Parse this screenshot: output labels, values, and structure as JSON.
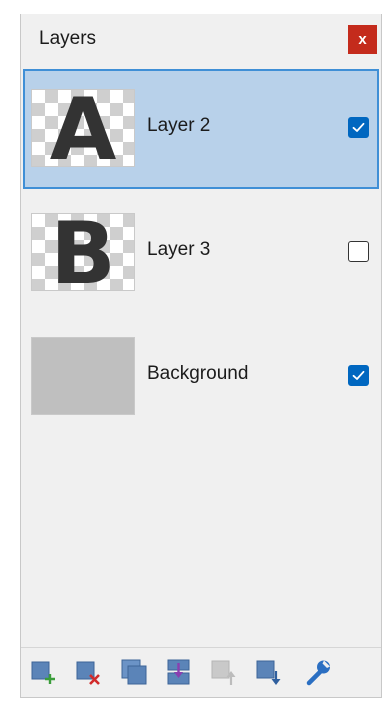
{
  "panel": {
    "title": "Layers",
    "close_label": "x"
  },
  "layers": [
    {
      "name": "Layer 2",
      "thumbnail_letter": "A",
      "visible": true,
      "selected": true
    },
    {
      "name": "Layer 3",
      "thumbnail_letter": "B",
      "visible": false,
      "selected": false
    },
    {
      "name": "Background",
      "thumbnail_letter": "",
      "visible": true,
      "selected": false
    }
  ],
  "toolbar": {
    "tools": [
      {
        "icon": "add-layer-icon",
        "enabled": true
      },
      {
        "icon": "delete-layer-icon",
        "enabled": true
      },
      {
        "icon": "duplicate-layer-icon",
        "enabled": true
      },
      {
        "icon": "merge-layer-down-icon",
        "enabled": true
      },
      {
        "icon": "move-layer-up-icon",
        "enabled": false
      },
      {
        "icon": "move-layer-down-icon",
        "enabled": true
      },
      {
        "icon": "layer-properties-icon",
        "enabled": true
      }
    ]
  },
  "colors": {
    "selected_row": "#b8d1ea",
    "selected_border": "#3f8fd6",
    "checkbox_on": "#0067c0",
    "close_button": "#c42b1c"
  }
}
